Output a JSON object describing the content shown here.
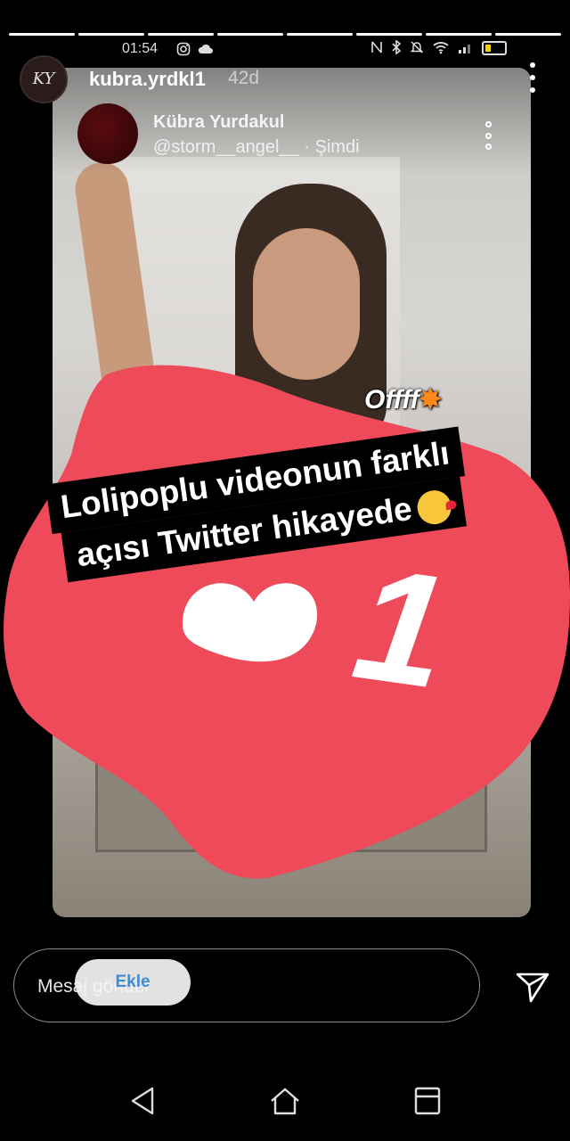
{
  "status_bar": {
    "time": "01:54",
    "left_icons": [
      "instagram-icon",
      "cloud-icon"
    ],
    "right_icons": [
      "nfc-icon",
      "bluetooth-icon",
      "mute-icon",
      "wifi-icon",
      "signal-icon",
      "battery-icon"
    ],
    "battery_level": 0.2
  },
  "story": {
    "segments_total": 8,
    "segments_done": 8,
    "username": "kubra.yrdkl1",
    "time_ago": "42d"
  },
  "embedded_tweet": {
    "name": "Kübra Yurdakul",
    "handle_time": "@storm__angel__ · Şimdi",
    "overlay_text": "Offff"
  },
  "sticker": {
    "like_count": "1",
    "caption_line_1": "Lolipoplu videonun farklı",
    "caption_line_2": "açısı Twitter hikayede"
  },
  "reply": {
    "placeholder": "Mesaj gönder",
    "add_button_label": "Ekle"
  },
  "colors": {
    "sticker_red": "#ee4a5a",
    "caption_bg": "#000000",
    "link_blue": "#2b83d6"
  }
}
